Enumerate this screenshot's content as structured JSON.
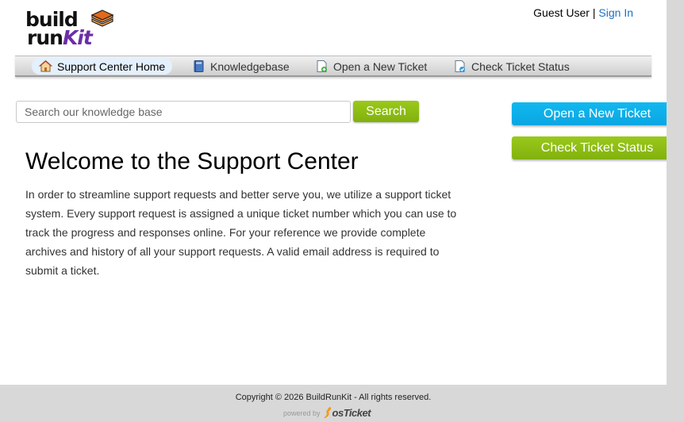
{
  "logo": {
    "line1": "build",
    "line2_prefix": "run",
    "line2_kit": "Kit",
    "name": "BuildRunKit"
  },
  "userbar": {
    "guest": "Guest User",
    "separator": "|",
    "signin": "Sign In"
  },
  "nav": {
    "items": [
      {
        "label": "Support Center Home",
        "icon": "home-icon"
      },
      {
        "label": "Knowledgebase",
        "icon": "book-icon"
      },
      {
        "label": "Open a New Ticket",
        "icon": "new-ticket-icon"
      },
      {
        "label": "Check Ticket Status",
        "icon": "ticket-status-icon"
      }
    ]
  },
  "search": {
    "placeholder": "Search our knowledge base",
    "button": "Search"
  },
  "sidebar": {
    "open_ticket": "Open a New Ticket",
    "check_status": "Check Ticket Status"
  },
  "welcome": {
    "title": "Welcome to the Support Center",
    "body": "In order to streamline support requests and better serve you, we utilize a support ticket system. Every support request is assigned a unique ticket number which you can use to track the progress and responses online. For your reference we provide complete archives and history of all your support requests. A valid email address is required to submit a ticket."
  },
  "footer": {
    "copyright": "Copyright © 2026 BuildRunKit - All rights reserved.",
    "powered_by": "powered by",
    "os_text": "osTicket"
  },
  "colors": {
    "link": "#1d6fc0",
    "green_button": "#8dbd14",
    "blue_button": "#0fb0ea",
    "kit_purple": "#6b2fa6"
  }
}
